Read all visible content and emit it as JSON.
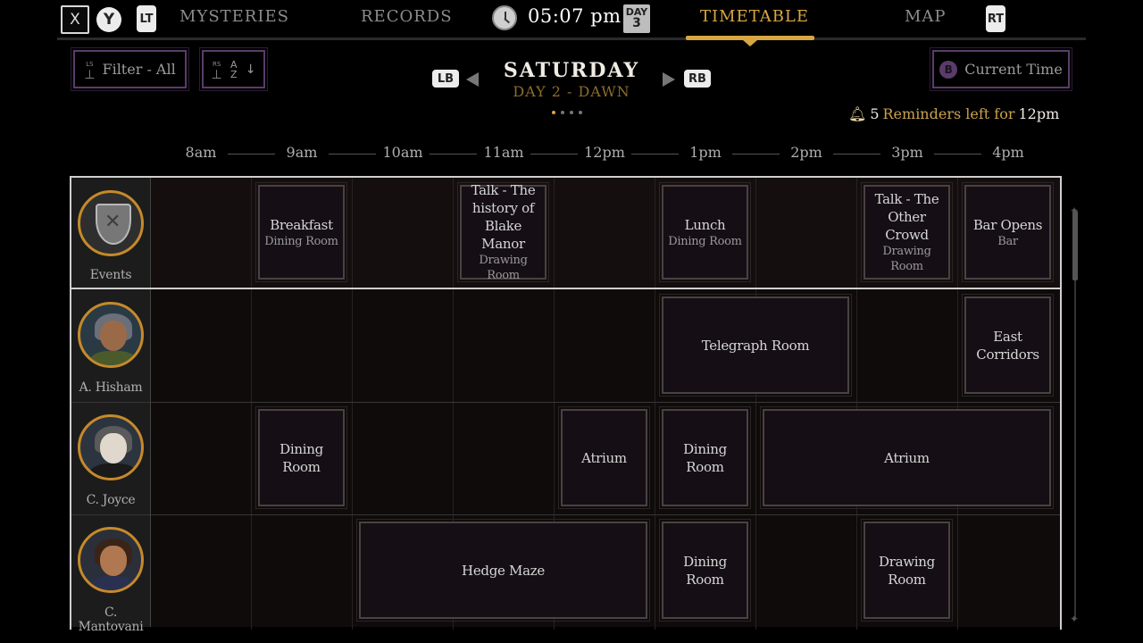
{
  "top_bar": {
    "buttons": {
      "x": "X",
      "y": "Y",
      "lt": "LT",
      "rt": "RT"
    },
    "tabs": [
      {
        "label": "MYSTERIES"
      },
      {
        "label": "RECORDS"
      },
      {
        "label": "TIMETABLE",
        "active": true
      },
      {
        "label": "MAP"
      }
    ],
    "time": "05:07 pm",
    "day_badge": {
      "label": "DAY",
      "number": "3"
    }
  },
  "controls": {
    "filter_label": "Filter - All",
    "filter_hint": "LS",
    "sort_hint": "RS",
    "sort_glyph": "A Z",
    "current_time_key": "B",
    "current_time_label": "Current Time"
  },
  "day_nav": {
    "prev_key": "LB",
    "next_key": "RB",
    "title": "SATURDAY",
    "subtitle": "DAY 2 - DAWN",
    "page_count": 4,
    "page_active": 0
  },
  "reminders": {
    "count": "5",
    "text": "Reminders left for",
    "time": "12pm"
  },
  "hours": [
    "8am",
    "9am",
    "10am",
    "11am",
    "12pm",
    "1pm",
    "2pm",
    "3pm",
    "4pm"
  ],
  "rows": [
    {
      "name": "Events",
      "kind": "events",
      "entries": [
        {
          "title": "Breakfast",
          "place": "Dining Room"
        },
        {
          "title": "Talk - The history of Blake Manor",
          "place": "Drawing Room"
        },
        {
          "title": "Lunch",
          "place": "Dining Room"
        },
        {
          "title": "Talk - The Other Crowd",
          "place": "Drawing Room"
        },
        {
          "title": "Bar Opens",
          "place": "Bar"
        }
      ]
    },
    {
      "name": "A. Hisham",
      "kind": "person",
      "entries": [
        {
          "title": "Telegraph Room"
        },
        {
          "title": "East Corridors"
        }
      ]
    },
    {
      "name": "C. Joyce",
      "kind": "person",
      "entries": [
        {
          "title": "Dining Room"
        },
        {
          "title": "Atrium"
        },
        {
          "title": "Dining Room"
        },
        {
          "title": "Atrium"
        }
      ]
    },
    {
      "name": "C. Mantovani",
      "kind": "person",
      "entries": [
        {
          "title": "Hedge Maze"
        },
        {
          "title": "Dining Room"
        },
        {
          "title": "Drawing Room"
        }
      ]
    }
  ],
  "icons": {
    "clock": "clock-icon",
    "bell": "bell-icon",
    "filter": "filter-icon",
    "sort": "sort-icon",
    "events": "shield-crest-icon"
  },
  "colors": {
    "accent_gold": "#d8a642",
    "frame_purple": "#5a3c6a",
    "portrait_ring": "#c58a2a"
  }
}
